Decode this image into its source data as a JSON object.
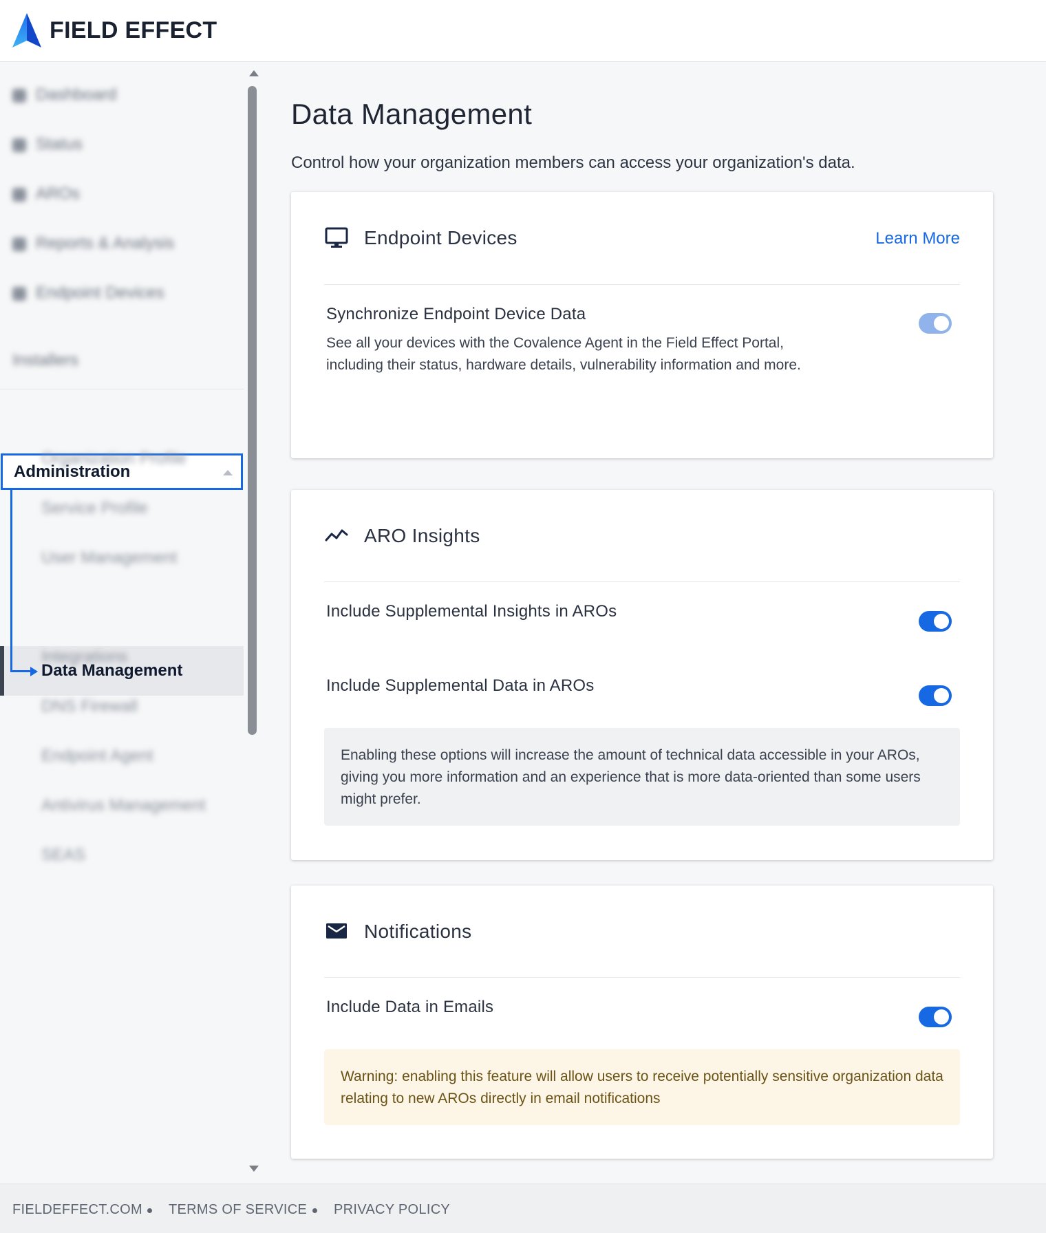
{
  "brand": {
    "name": "FIELD EFFECT",
    "logo_icon": "field-effect-logo",
    "colors": {
      "accent": "#1668e3",
      "text": "#1f2533",
      "warning_bg": "#fdf6e7",
      "warning_text": "#6b5316"
    }
  },
  "sidebar": {
    "items": [
      {
        "label": "Dashboard",
        "icon": "dashboard-icon"
      },
      {
        "label": "Status",
        "icon": "status-icon"
      },
      {
        "label": "AROs",
        "icon": "aro-icon"
      },
      {
        "label": "Reports & Analysis",
        "icon": "reports-icon"
      },
      {
        "label": "Endpoint Devices",
        "icon": "devices-icon"
      }
    ],
    "installers_label": "Installers",
    "administration": {
      "label": "Administration",
      "expanded": true,
      "children": [
        {
          "label": "Organization Profile"
        },
        {
          "label": "Service Profile"
        },
        {
          "label": "User Management"
        },
        {
          "label": "Data Management",
          "active": true
        },
        {
          "label": "Integrations"
        },
        {
          "label": "DNS Firewall"
        },
        {
          "label": "Endpoint Agent"
        },
        {
          "label": "Antivirus Management"
        },
        {
          "label": "SEAS"
        }
      ]
    }
  },
  "main": {
    "title": "Data Management",
    "description": "Control how your organization members can access your organization's data.",
    "cards": {
      "endpoint": {
        "title": "Endpoint Devices",
        "icon": "monitor-icon",
        "link": "Learn More",
        "setting": {
          "label": "Synchronize Endpoint Device Data",
          "description": "See all your devices with the Covalence Agent in the Field Effect Portal, including their status, hardware details, vulnerability information and more.",
          "enabled": true,
          "disabled_style": true
        }
      },
      "aro": {
        "title": "ARO Insights",
        "icon": "trend-line-icon",
        "settings": [
          {
            "label": "Include Supplemental Insights in AROs",
            "enabled": true
          },
          {
            "label": "Include Supplemental Data in AROs",
            "enabled": true
          }
        ],
        "info": "Enabling these options will increase the amount of technical data accessible in your AROs, giving you more information and an experience that is more data-oriented than some users might prefer."
      },
      "notifications": {
        "title": "Notifications",
        "icon": "envelope-icon",
        "setting": {
          "label": "Include Data in Emails",
          "enabled": true
        },
        "warning": "Warning: enabling this feature will allow users to receive potentially sensitive organization data relating to new AROs directly in email notifications"
      }
    }
  },
  "footer": {
    "links": [
      "FIELDEFFECT.COM",
      "TERMS OF SERVICE",
      "PRIVACY POLICY"
    ]
  }
}
